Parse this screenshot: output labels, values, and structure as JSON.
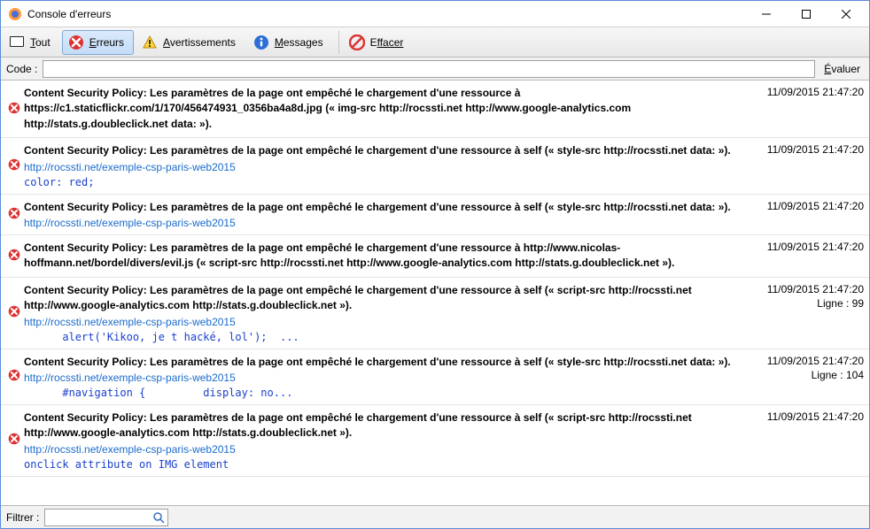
{
  "window": {
    "title": "Console d'erreurs"
  },
  "toolbar": {
    "all": "out",
    "all_prefix": "T",
    "errors": "rreurs",
    "errors_prefix": "E",
    "warnings": "vertissements",
    "warnings_prefix": "A",
    "messages": "essages",
    "messages_prefix": "M",
    "clear_prefix": "E",
    "clear": "ffacer"
  },
  "codebar": {
    "label": "Code :",
    "value": "",
    "evaluate_prefix": "É",
    "evaluate": "valuer"
  },
  "filterbar": {
    "label": "Filtrer :",
    "value": ""
  },
  "entries": [
    {
      "message": "Content Security Policy: Les paramètres de la page ont empêché le chargement d'une ressource à https://c1.staticflickr.com/1/170/456474931_0356ba4a8d.jpg (« img-src http://rocssti.net http://www.google-analytics.com http://stats.g.doubleclick.net data: »).",
      "timestamp": "11/09/2015 21:47:20"
    },
    {
      "message": "Content Security Policy: Les paramètres de la page ont empêché le chargement d'une ressource à self (« style-src http://rocssti.net data: »).",
      "link": "http://rocssti.net/exemple-csp-paris-web2015",
      "code": "color: red;",
      "timestamp": "11/09/2015 21:47:20"
    },
    {
      "message": "Content Security Policy: Les paramètres de la page ont empêché le chargement d'une ressource à self (« style-src http://rocssti.net data: »).",
      "link": "http://rocssti.net/exemple-csp-paris-web2015",
      "timestamp": "11/09/2015 21:47:20"
    },
    {
      "message": "Content Security Policy: Les paramètres de la page ont empêché le chargement d'une ressource à http://www.nicolas-hoffmann.net/bordel/divers/evil.js (« script-src http://rocssti.net http://www.google-analytics.com http://stats.g.doubleclick.net »).",
      "timestamp": "11/09/2015 21:47:20"
    },
    {
      "message": "Content Security Policy: Les paramètres de la page ont empêché le chargement d'une ressource à self (« script-src http://rocssti.net http://www.google-analytics.com http://stats.g.doubleclick.net »).",
      "link": "http://rocssti.net/exemple-csp-paris-web2015",
      "code": "      alert('Kikoo, je t hacké, lol');  ...",
      "timestamp": "11/09/2015 21:47:20",
      "line_label": "Ligne :",
      "line": "99"
    },
    {
      "message": "Content Security Policy: Les paramètres de la page ont empêché le chargement d'une ressource à self (« style-src http://rocssti.net data: »).",
      "link": "http://rocssti.net/exemple-csp-paris-web2015",
      "code": "      #navigation {         display: no...",
      "timestamp": "11/09/2015 21:47:20",
      "line_label": "Ligne :",
      "line": "104"
    },
    {
      "message": "Content Security Policy: Les paramètres de la page ont empêché le chargement d'une ressource à self (« script-src http://rocssti.net http://www.google-analytics.com http://stats.g.doubleclick.net »).",
      "link": "http://rocssti.net/exemple-csp-paris-web2015",
      "code": "onclick attribute on IMG element",
      "timestamp": "11/09/2015 21:47:20"
    }
  ]
}
